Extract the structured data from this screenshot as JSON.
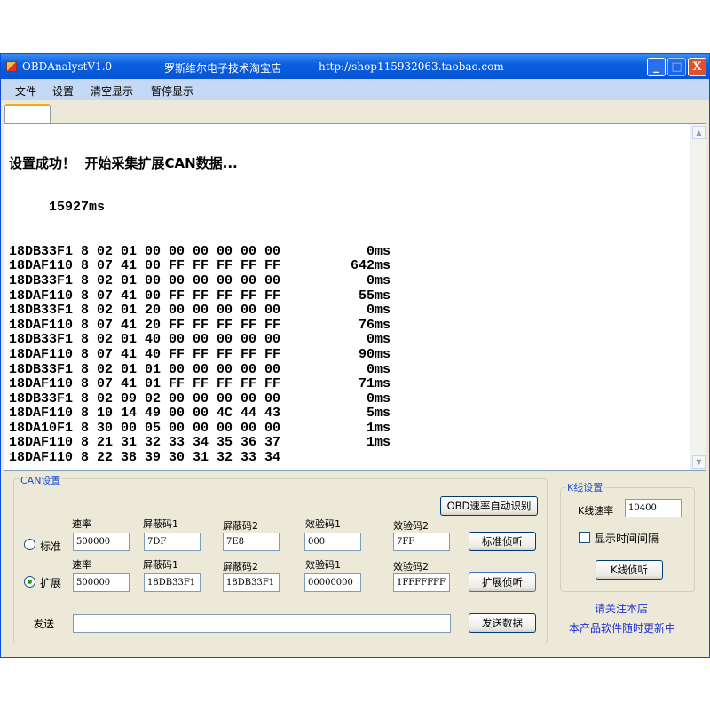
{
  "window": {
    "app_title": "OBDAnalystV1.0",
    "shop_name": "罗斯维尔电子技术淘宝店",
    "shop_url": "http://shop115932063.taobao.com"
  },
  "menu": [
    "文件",
    "设置",
    "清空显示",
    "暂停显示"
  ],
  "log": {
    "header": "设置成功！  开始采集扩展CAN数据...",
    "elapsed": "15927ms",
    "rows": [
      {
        "frame": "18DB33F1 8 02 01 00 00 00 00 00 00",
        "time": "0ms"
      },
      {
        "frame": "18DAF110 8 07 41 00 FF FF FF FF FF",
        "time": "642ms"
      },
      {
        "frame": "18DB33F1 8 02 01 00 00 00 00 00 00",
        "time": "0ms"
      },
      {
        "frame": "18DAF110 8 07 41 00 FF FF FF FF FF",
        "time": "55ms"
      },
      {
        "frame": "18DB33F1 8 02 01 20 00 00 00 00 00",
        "time": "0ms"
      },
      {
        "frame": "18DAF110 8 07 41 20 FF FF FF FF FF",
        "time": "76ms"
      },
      {
        "frame": "18DB33F1 8 02 01 40 00 00 00 00 00",
        "time": "0ms"
      },
      {
        "frame": "18DAF110 8 07 41 40 FF FF FF FF FF",
        "time": "90ms"
      },
      {
        "frame": "18DB33F1 8 02 01 01 00 00 00 00 00",
        "time": "0ms"
      },
      {
        "frame": "18DAF110 8 07 41 01 FF FF FF FF FF",
        "time": "71ms"
      },
      {
        "frame": "18DB33F1 8 02 09 02 00 00 00 00 00",
        "time": "0ms"
      },
      {
        "frame": "18DAF110 8 10 14 49 00 00 4C 44 43",
        "time": "5ms"
      },
      {
        "frame": "18DA10F1 8 30 00 05 00 00 00 00 00",
        "time": "1ms"
      },
      {
        "frame": "18DAF110 8 21 31 32 33 34 35 36 37",
        "time": "1ms"
      },
      {
        "frame": "18DAF110 8 22 38 39 30 31 32 33 34",
        "time": ""
      }
    ]
  },
  "can": {
    "title": "CAN设置",
    "auto_detect_button": "OBD速率自动识别",
    "field_labels": [
      "速率",
      "屏蔽码1",
      "屏蔽码2",
      "效验码1",
      "效验码2"
    ],
    "standard": {
      "label": "标准",
      "selected": false,
      "values": [
        "500000",
        "7DF",
        "7E8",
        "000",
        "7FF"
      ],
      "button": "标准侦听"
    },
    "extended": {
      "label": "扩展",
      "selected": true,
      "values": [
        "500000",
        "18DB33F1",
        "18DB33F1",
        "00000000",
        "1FFFFFFF"
      ],
      "button": "扩展侦听"
    },
    "send_label": "发送",
    "send_value": "",
    "send_button": "发送数据"
  },
  "kline": {
    "title": "K线设置",
    "rate_label": "K线速率",
    "rate_value": "10400",
    "show_interval_label": "显示时间间隔",
    "show_interval_checked": false,
    "listen_button": "K线侦听"
  },
  "notes": [
    "请关注本店",
    "本产品软件随时更新中"
  ]
}
